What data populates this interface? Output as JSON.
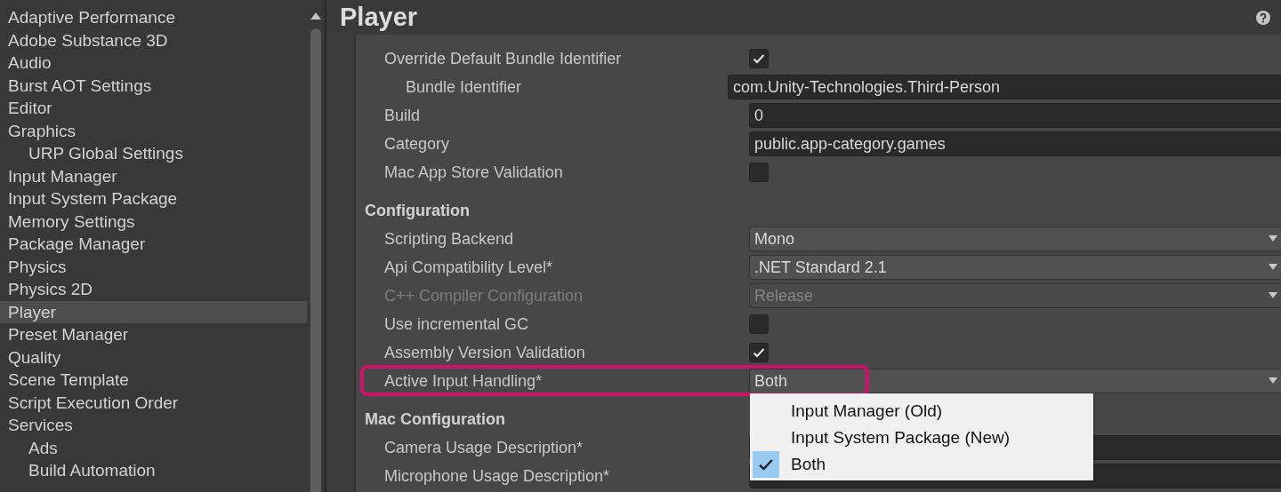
{
  "sidebar": {
    "items": [
      {
        "label": "Adaptive Performance",
        "selected": false
      },
      {
        "label": "Adobe Substance 3D",
        "selected": false
      },
      {
        "label": "Audio",
        "selected": false
      },
      {
        "label": "Burst AOT Settings",
        "selected": false
      },
      {
        "label": "Editor",
        "selected": false
      },
      {
        "label": "Graphics",
        "selected": false,
        "children": [
          {
            "label": "URP Global Settings",
            "selected": false
          }
        ]
      },
      {
        "label": "Input Manager",
        "selected": false
      },
      {
        "label": "Input System Package",
        "selected": false
      },
      {
        "label": "Memory Settings",
        "selected": false
      },
      {
        "label": "Package Manager",
        "selected": false
      },
      {
        "label": "Physics",
        "selected": false
      },
      {
        "label": "Physics 2D",
        "selected": false
      },
      {
        "label": "Player",
        "selected": true
      },
      {
        "label": "Preset Manager",
        "selected": false
      },
      {
        "label": "Quality",
        "selected": false
      },
      {
        "label": "Scene Template",
        "selected": false
      },
      {
        "label": "Script Execution Order",
        "selected": false
      },
      {
        "label": "Services",
        "selected": false,
        "children": [
          {
            "label": "Ads",
            "selected": false
          },
          {
            "label": "Build Automation",
            "selected": false
          }
        ]
      }
    ]
  },
  "panel": {
    "title": "Player",
    "rows": [
      {
        "kind": "checkbox",
        "label": "Override Default Bundle Identifier",
        "checked": true,
        "disabled": false,
        "highlighted": false,
        "children": [
          {
            "kind": "text",
            "label": "Bundle Identifier",
            "value": "com.Unity-Technologies.Third-Person",
            "disabled": false,
            "highlighted": false
          }
        ]
      },
      {
        "kind": "text",
        "label": "Build",
        "value": "0",
        "disabled": false,
        "highlighted": false
      },
      {
        "kind": "text",
        "label": "Category",
        "value": "public.app-category.games",
        "disabled": false,
        "highlighted": false
      },
      {
        "kind": "checkbox",
        "label": "Mac App Store Validation",
        "checked": false,
        "disabled": false,
        "highlighted": false
      },
      {
        "kind": "section",
        "label": "Configuration"
      },
      {
        "kind": "dropdown",
        "label": "Scripting Backend",
        "value": "Mono",
        "disabled": false,
        "highlighted": false
      },
      {
        "kind": "dropdown",
        "label": "Api Compatibility Level*",
        "value": ".NET Standard 2.1",
        "disabled": false,
        "highlighted": false
      },
      {
        "kind": "dropdown",
        "label": "C++ Compiler Configuration",
        "value": "Release",
        "disabled": true,
        "highlighted": false
      },
      {
        "kind": "checkbox",
        "label": "Use incremental GC",
        "checked": false,
        "disabled": false,
        "highlighted": false
      },
      {
        "kind": "checkbox",
        "label": "Assembly Version Validation",
        "checked": true,
        "disabled": false,
        "highlighted": false
      },
      {
        "kind": "dropdown",
        "label": "Active Input Handling*",
        "value": "Both",
        "disabled": false,
        "highlighted": true,
        "menu": [
          {
            "label": "Input Manager (Old)",
            "selected": false
          },
          {
            "label": "Input System Package (New)",
            "selected": false
          },
          {
            "label": "Both",
            "selected": true
          }
        ]
      },
      {
        "kind": "section",
        "label": "Mac Configuration"
      },
      {
        "kind": "text",
        "label": "Camera Usage Description*",
        "disabled": false,
        "highlighted": false
      },
      {
        "kind": "text",
        "label": "Microphone Usage Description*",
        "disabled": false,
        "highlighted": false
      }
    ]
  }
}
